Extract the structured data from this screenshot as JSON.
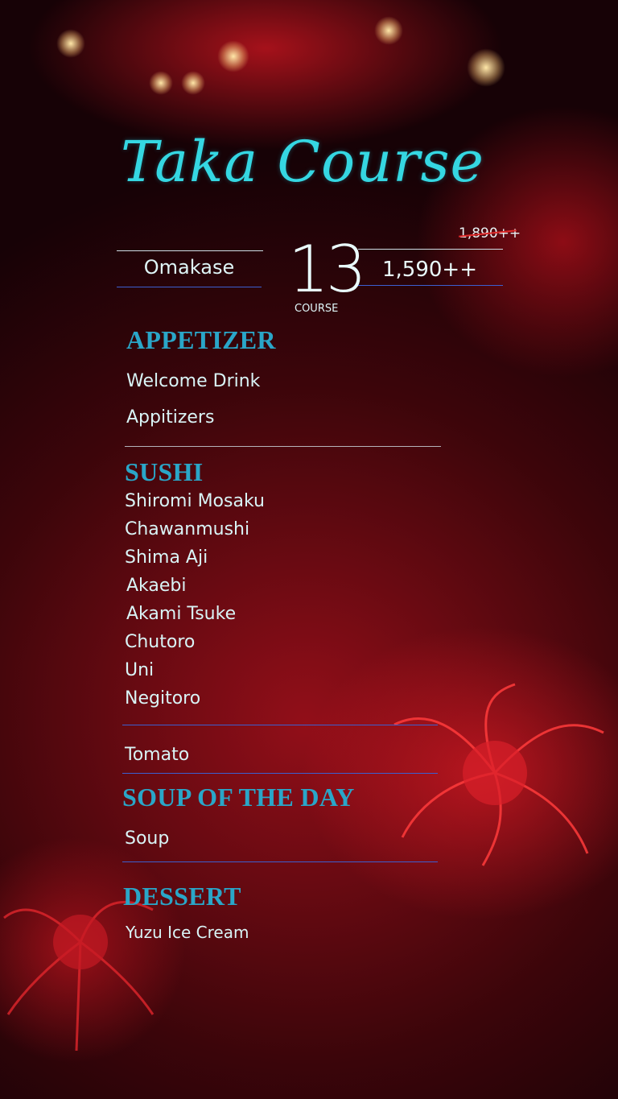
{
  "title": "Taka Course",
  "header": {
    "plan": "Omakase",
    "course_count": "13",
    "course_label": "COURSE",
    "old_price": "1,890++",
    "new_price": "1,590++"
  },
  "sections": {
    "appetizer": {
      "title": "APPETIZER",
      "items": [
        "Welcome Drink",
        "Appitizers"
      ]
    },
    "sushi": {
      "title": "SUSHI",
      "items": [
        "Shiromi Mosaku",
        "Chawanmushi",
        "Shima Aji",
        "Akaebi",
        "Akami Tsuke",
        "Chutoro",
        "Uni",
        "Negitoro"
      ]
    },
    "extra": {
      "items": [
        "Tomato"
      ]
    },
    "soup": {
      "title": "SOUP OF THE DAY",
      "items": [
        "Soup"
      ]
    },
    "dessert": {
      "title": "DESSERT",
      "items": [
        "Yuzu Ice Cream"
      ]
    }
  },
  "colors": {
    "title": "#35d7e2",
    "section_heading": "#2aa6c8",
    "background": "#7a0c18",
    "strike": "#e02a2a"
  }
}
